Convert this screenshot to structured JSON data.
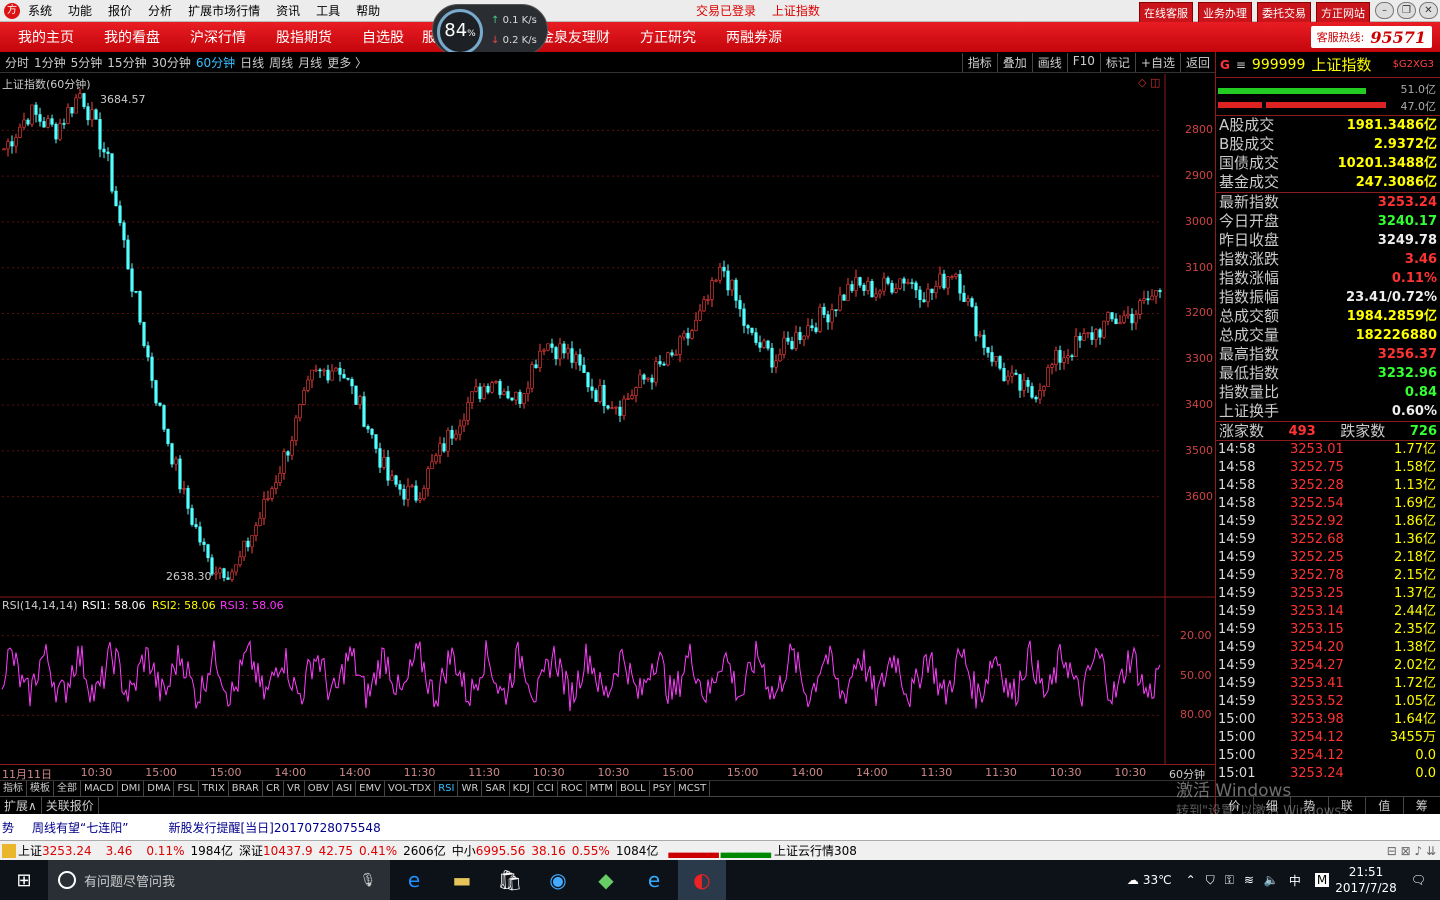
{
  "menubar": {
    "items": [
      "系统",
      "功能",
      "报价",
      "分析",
      "扩展市场行情",
      "资讯",
      "工具",
      "帮助"
    ],
    "login_status": "交易已登录",
    "current_index": "上证指数",
    "buttons": [
      "在线客服",
      "业务办理",
      "委托交易",
      "方正网站"
    ]
  },
  "speed": {
    "percent": "84",
    "unit": "%",
    "up": "0.1",
    "down": "0.2",
    "rate_unit": "K/s"
  },
  "nav": {
    "items": [
      "我的主页",
      "我的看盘",
      "沪深行情",
      "股指期货",
      "自选股",
      "服务",
      "台",
      "金泉友理财",
      "方正研究",
      "两融券源"
    ],
    "hotline_label": "客服热线:",
    "hotline_number": "95571"
  },
  "periods": {
    "items": [
      "分时",
      "1分钟",
      "5分钟",
      "15分钟",
      "30分钟",
      "60分钟",
      "日线",
      "周线",
      "月线",
      "更多 〉"
    ],
    "active": "60分钟"
  },
  "tools": [
    "指标",
    "叠加",
    "画线",
    "F10",
    "标记",
    "+自选",
    "返回"
  ],
  "chart": {
    "title": "上证指数(60分钟)",
    "max_label": "3684.57",
    "min_label": "2638.30",
    "y_ticks": [
      "3600",
      "3500",
      "3400",
      "3300",
      "3200",
      "3100",
      "3000",
      "2900",
      "2800"
    ],
    "rsi_title": "RSI(14,14,14)",
    "rsi1_label": "RSI1: 58.06",
    "rsi2_label": "RSI2: 58.06",
    "rsi3_label": "RSI3: 58.06",
    "rsi_ticks": [
      "80.00",
      "50.00",
      "20.00"
    ],
    "period_label": "60分钟"
  },
  "chart_data": {
    "type": "candlestick",
    "title": "上证指数(60分钟)",
    "ylim": [
      2620,
      3710
    ],
    "y_ticks": [
      2800,
      2900,
      3000,
      3100,
      3200,
      3300,
      3400,
      3500,
      3600
    ],
    "max": 3684.57,
    "min": 2638.3,
    "x_labels": [
      "11月11日",
      "10:30",
      "15:00",
      "15:00",
      "14:00",
      "14:00",
      "11:30",
      "11:30",
      "10:30",
      "10:30",
      "15:00",
      "15:00",
      "14:00",
      "14:00",
      "11:30",
      "11:30",
      "10:30",
      "10:30"
    ],
    "trend_points": [
      3560,
      3640,
      3600,
      3684.57,
      3540,
      3260,
      3000,
      2800,
      2650,
      2638.3,
      2760,
      2900,
      3060,
      3090,
      2980,
      2830,
      2800,
      2900,
      3000,
      3060,
      3010,
      3140,
      3110,
      3030,
      3000,
      3060,
      3100,
      3180,
      3300,
      3150,
      3100,
      3160,
      3200,
      3260,
      3250,
      3280,
      3240,
      3300,
      3150,
      3060,
      3020,
      3100,
      3140,
      3180,
      3200,
      3253.24
    ],
    "rsi": {
      "ylim": [
        0,
        100
      ],
      "ticks": [
        20,
        50,
        80
      ],
      "last": 58.06
    }
  },
  "side": {
    "flag": "G",
    "code": "999999",
    "name": "上证指数",
    "sign": "$G2XG3",
    "up_pct": "51.0亿",
    "down_pct": "47.0亿",
    "turnover": [
      {
        "k": "A股成交",
        "v": "1981.3486亿"
      },
      {
        "k": "B股成交",
        "v": "2.9372亿"
      },
      {
        "k": "国债成交",
        "v": "10201.3488亿"
      },
      {
        "k": "基金成交",
        "v": "247.3086亿"
      }
    ],
    "stats": [
      {
        "k": "最新指数",
        "v": "3253.24",
        "c": "#f33"
      },
      {
        "k": "今日开盘",
        "v": "3240.17",
        "c": "#3f3"
      },
      {
        "k": "昨日收盘",
        "v": "3249.78",
        "c": "#eee"
      },
      {
        "k": "指数涨跌",
        "v": "3.46",
        "c": "#f33"
      },
      {
        "k": "指数涨幅",
        "v": "0.11%",
        "c": "#f33"
      },
      {
        "k": "指数振幅",
        "v": "23.41/0.72%",
        "c": "#eee"
      },
      {
        "k": "总成交额",
        "v": "1984.2859亿",
        "c": "#ff0"
      },
      {
        "k": "总成交量",
        "v": "182226880",
        "c": "#ff0"
      },
      {
        "k": "最高指数",
        "v": "3256.37",
        "c": "#f33"
      },
      {
        "k": "最低指数",
        "v": "3232.96",
        "c": "#3f3"
      },
      {
        "k": "指数量比",
        "v": "0.84",
        "c": "#3f3"
      },
      {
        "k": "上证换手",
        "v": "0.60%",
        "c": "#eee"
      }
    ],
    "rise_label": "涨家数",
    "rise": "493",
    "fall_label": "跌家数",
    "fall": "726",
    "ticks": [
      [
        "14:58",
        "3253.01",
        "1.77亿"
      ],
      [
        "14:58",
        "3252.75",
        "1.58亿"
      ],
      [
        "14:58",
        "3252.28",
        "1.13亿"
      ],
      [
        "14:58",
        "3252.54",
        "1.69亿"
      ],
      [
        "14:59",
        "3252.92",
        "1.86亿"
      ],
      [
        "14:59",
        "3252.68",
        "1.36亿"
      ],
      [
        "14:59",
        "3252.25",
        "2.18亿"
      ],
      [
        "14:59",
        "3252.78",
        "2.15亿"
      ],
      [
        "14:59",
        "3253.25",
        "1.37亿"
      ],
      [
        "14:59",
        "3253.14",
        "2.44亿"
      ],
      [
        "14:59",
        "3253.15",
        "2.35亿"
      ],
      [
        "14:59",
        "3254.20",
        "1.38亿"
      ],
      [
        "14:59",
        "3254.27",
        "2.02亿"
      ],
      [
        "14:59",
        "3253.41",
        "1.72亿"
      ],
      [
        "14:59",
        "3253.52",
        "1.05亿"
      ],
      [
        "15:00",
        "3253.98",
        "1.64亿"
      ],
      [
        "15:00",
        "3254.12",
        "3455万"
      ],
      [
        "15:00",
        "3254.12",
        "0.0"
      ],
      [
        "15:01",
        "3253.24",
        "0.0"
      ]
    ],
    "tabs": [
      "价",
      "细",
      "势",
      "联",
      "值",
      "筹"
    ]
  },
  "indicators": [
    "指标",
    "模板",
    "全部",
    "MACD",
    "DMI",
    "DMA",
    "FSL",
    "TRIX",
    "BRAR",
    "CR",
    "VR",
    "OBV",
    "ASI",
    "EMV",
    "VOL-TDX",
    "RSI",
    "WR",
    "SAR",
    "KDJ",
    "CCI",
    "ROC",
    "MTM",
    "BOLL",
    "PSY",
    "MCST"
  ],
  "indicators_active": "RSI",
  "ext_tabs": [
    "扩展∧",
    "关联报价"
  ],
  "ticker": [
    "势",
    "周线有望“七连阳”",
    "新股发行提醒[当日]20170728075548"
  ],
  "status": {
    "sh_label": "上证",
    "sh": "3253.24",
    "sh_chg": "3.46",
    "sh_pct": "0.11%",
    "sh_amt": "1984亿",
    "sz_label": "深证",
    "sz": "10437.9",
    "sz_chg": "42.75",
    "sz_pct": "0.41%",
    "sz_amt": "2606亿",
    "zx_label": "中小",
    "zx": "6995.56",
    "zx_chg": "38.16",
    "zx_pct": "0.55%",
    "zx_amt": "1084亿",
    "cloud": "上证云行情308"
  },
  "taskbar": {
    "search_placeholder": "有问题尽管问我",
    "weather": "33℃",
    "ime": "中",
    "ime2": "M",
    "time": "21:51",
    "date": "2017/7/28"
  },
  "watermark": {
    "line1": "激活 Windows",
    "line2": "转到\"设置\"以激活 Windows。"
  }
}
